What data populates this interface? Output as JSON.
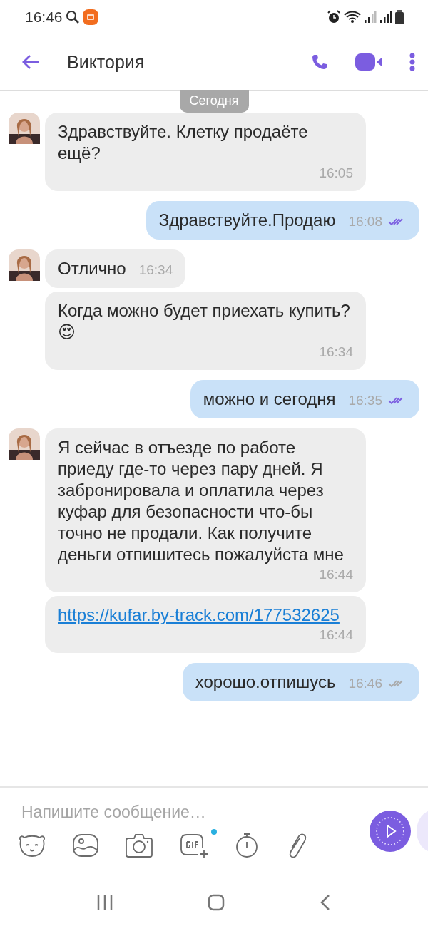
{
  "status_bar": {
    "time": "16:46"
  },
  "header": {
    "title": "Виктория"
  },
  "date_label": "Сегодня",
  "messages": [
    {
      "kind": "in",
      "avatar": true,
      "text": "Здравствуйте. Клетку продаёте ещё?",
      "time": "16:05"
    },
    {
      "kind": "out",
      "text": "Здравствуйте.Продаю",
      "time": "16:08",
      "read": true
    },
    {
      "kind": "in",
      "avatar": true,
      "text": "Отлично",
      "time": "16:34"
    },
    {
      "kind": "in",
      "avatar": false,
      "text": "Когда можно будет приехать купить? 😍",
      "time": "16:34"
    },
    {
      "kind": "out",
      "text": "можно и сегодня",
      "time": "16:35",
      "read": true
    },
    {
      "kind": "in",
      "avatar": true,
      "text": "Я сейчас в отъезде по работе приеду где-то через пару дней. Я забронировала и оплатила через куфар для безопасности что-бы точно не продали. Как получите деньги отпишитесь пожалуйста мне",
      "time": "16:44"
    },
    {
      "kind": "link",
      "avatar": false,
      "text": "https://kufar.by-track.com/177532625",
      "time": "16:44"
    },
    {
      "kind": "out",
      "text": "хорошо.отпишусь",
      "time": "16:46",
      "read": false
    }
  ],
  "composer": {
    "placeholder": "Напишите сообщение…",
    "gif_badge": true
  }
}
